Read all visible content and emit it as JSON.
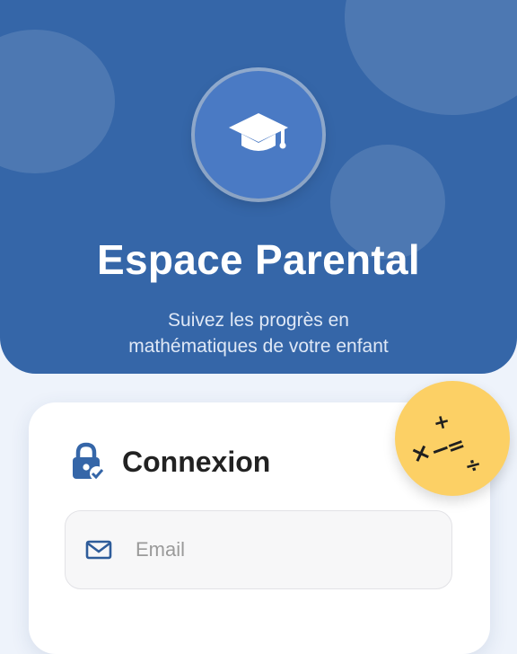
{
  "header": {
    "title": "Espace Parental",
    "subtitle_line1": "Suivez les progrès en",
    "subtitle_line2": "mathématiques de votre enfant",
    "logo_icon": "graduation-cap-icon"
  },
  "login_card": {
    "title": "Connexion",
    "title_icon": "lock-check-icon",
    "email": {
      "icon": "envelope-icon",
      "placeholder": "Email",
      "value": ""
    }
  },
  "math_badge": {
    "symbols": [
      "+",
      "×",
      "−",
      "=",
      "÷"
    ]
  },
  "colors": {
    "primary": "#3566a8",
    "logo_circle": "#4a7ac4",
    "accent_yellow": "#fcd065",
    "background": "#eef3fb"
  }
}
